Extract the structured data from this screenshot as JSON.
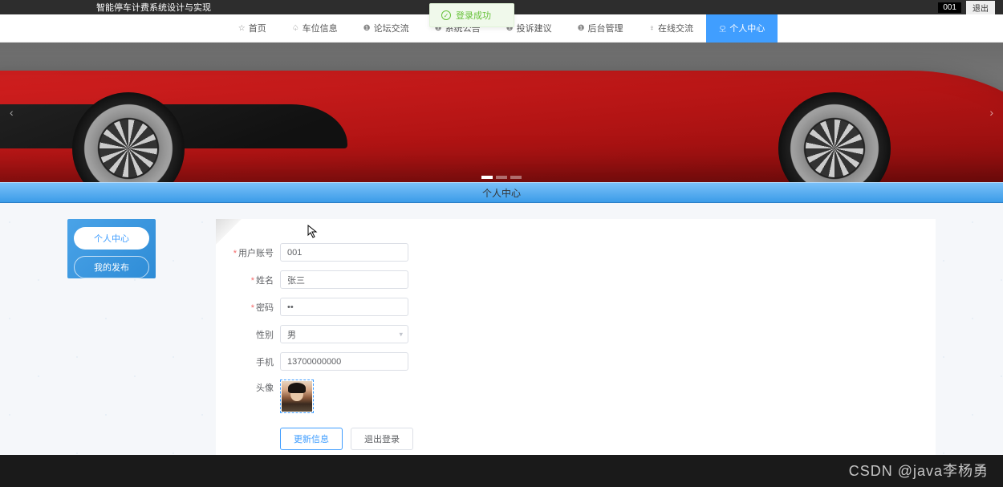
{
  "app": {
    "title": "智能停车计费系统设计与实现"
  },
  "top": {
    "user": "001",
    "logout": "退出"
  },
  "toast": {
    "text": "登录成功"
  },
  "nav": {
    "items": [
      {
        "icon": "☆",
        "label": "首页"
      },
      {
        "icon": "♤",
        "label": "车位信息"
      },
      {
        "icon": "❶",
        "label": "论坛交流"
      },
      {
        "icon": "❶",
        "label": "系统公告"
      },
      {
        "icon": "❶",
        "label": "投诉建议"
      },
      {
        "icon": "❶",
        "label": "后台管理"
      },
      {
        "icon": "♀",
        "label": "在线交流"
      },
      {
        "icon": "오",
        "label": "个人中心"
      }
    ]
  },
  "section": {
    "title": "个人中心"
  },
  "sidebar": {
    "items": [
      {
        "label": "个人中心"
      },
      {
        "label": "我的发布"
      }
    ]
  },
  "form": {
    "account_label": "用户账号",
    "account_value": "001",
    "name_label": "姓名",
    "name_value": "张三",
    "pwd_label": "密码",
    "pwd_value": "••",
    "gender_label": "性别",
    "gender_value": "男",
    "phone_label": "手机",
    "phone_value": "13700000000",
    "avatar_label": "头像"
  },
  "buttons": {
    "update": "更新信息",
    "logout": "退出登录"
  },
  "watermark": "CSDN @java李杨勇"
}
